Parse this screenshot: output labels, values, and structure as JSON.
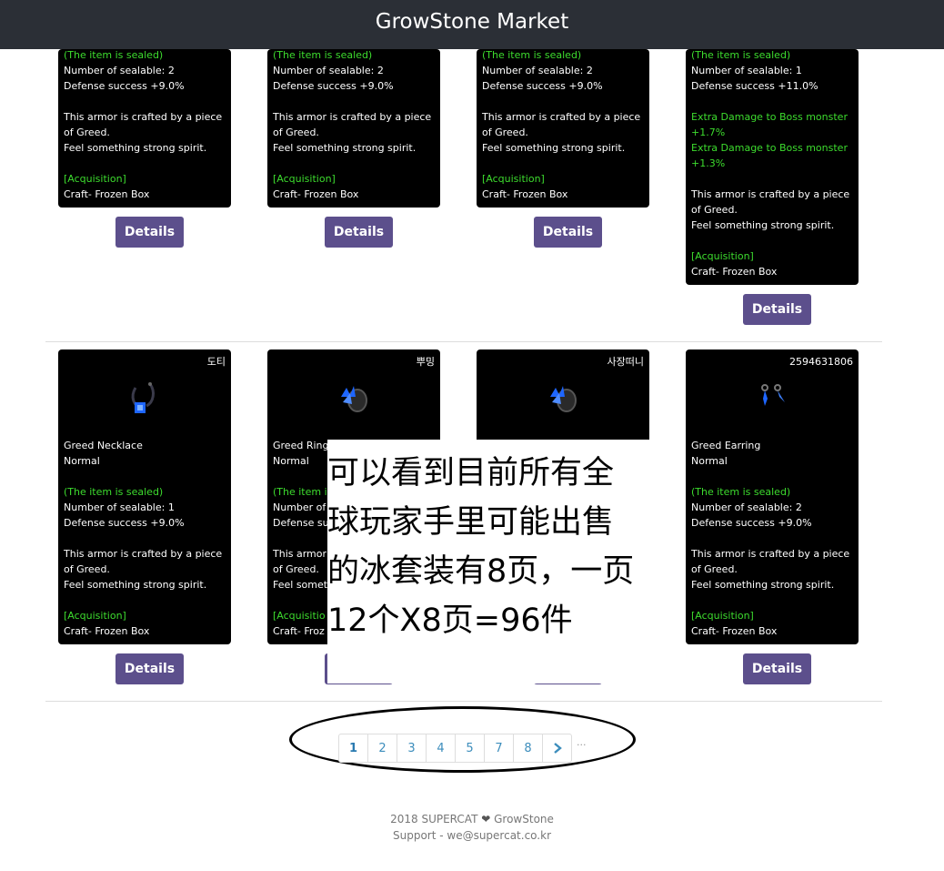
{
  "header": {
    "title": "GrowStone Market"
  },
  "details_label": "Details",
  "top_cards": [
    {
      "lines": [
        "(The item is sealed)",
        "Number of sealable: 2",
        "Defense success +9.0%",
        "",
        "This armor is crafted by a piece of Greed.",
        "Feel something strong spirit.",
        "",
        "[Acquisition]",
        "Craft- Frozen Box"
      ]
    },
    {
      "lines": [
        "(The item is sealed)",
        "Number of sealable: 2",
        "Defense success +9.0%",
        "",
        "This armor is crafted by a piece of Greed.",
        "Feel something strong spirit.",
        "",
        "[Acquisition]",
        "Craft- Frozen Box"
      ]
    },
    {
      "lines": [
        "(The item is sealed)",
        "Number of sealable: 2",
        "Defense success +9.0%",
        "",
        "This armor is crafted by a piece of Greed.",
        "Feel something strong spirit.",
        "",
        "[Acquisition]",
        "Craft- Frozen Box"
      ]
    },
    {
      "lines": [
        "(The item is sealed)",
        "Number of sealable: 1",
        "Defense success +11.0%",
        "",
        "Extra Damage to Boss monster +1.7%",
        "Extra Damage to Boss monster +1.3%",
        "",
        "This armor is crafted by a piece of Greed.",
        "Feel something strong spirit.",
        "",
        "[Acquisition]",
        "Craft- Frozen Box"
      ]
    }
  ],
  "bottom_cards": [
    {
      "seller": "도티",
      "icon": "necklace-icon",
      "name": "Greed Necklace",
      "grade": "Normal",
      "lines": [
        "(The item is sealed)",
        "Number of sealable: 1",
        "Defense success +9.0%",
        "",
        "This armor is crafted by a piece of Greed.",
        "Feel something strong spirit.",
        "",
        "[Acquisition]",
        "Craft- Frozen Box"
      ]
    },
    {
      "seller": "뿌밍",
      "icon": "ring-icon",
      "name": "Greed Ring",
      "grade": "Normal",
      "lines": [
        "(The item is sealed)",
        "Number of",
        "Defense su",
        "",
        "This armor",
        "of Greed.",
        "Feel somet",
        "",
        "[Acquisitio",
        "Craft- Froz"
      ]
    },
    {
      "seller": "사장떠니",
      "icon": "ring-icon",
      "name": "",
      "grade": "",
      "lines": []
    },
    {
      "seller": "2594631806",
      "icon": "earring-icon",
      "name": "Greed Earring",
      "grade": "Normal",
      "lines": [
        "(The item is sealed)",
        "Number of sealable: 2",
        "Defense success +9.0%",
        "",
        "This armor is crafted by a piece of Greed.",
        "Feel something strong spirit.",
        "",
        "[Acquisition]",
        "Craft- Frozen Box"
      ]
    }
  ],
  "overlay_note": [
    "可以看到目前所有全",
    "球玩家手里可能出售",
    "的冰套装有8页，一页",
    "12个X8页=96件"
  ],
  "pagination": {
    "pages": [
      "1",
      "2",
      "3",
      "4",
      "5",
      "7",
      "8"
    ],
    "active": "1",
    "next_icon": "chevron-right-icon",
    "ellipsis": "···"
  },
  "footer": {
    "copyright_left": "2018 SUPERCAT",
    "heart": "❤",
    "copyright_right": "GrowStone",
    "support": "Support - we@supercat.co.kr"
  },
  "colors": {
    "header_bg": "#2b2f36",
    "button": "#5c4f8c",
    "green_text": "#3ddc2e",
    "link": "#3c8dbc"
  }
}
